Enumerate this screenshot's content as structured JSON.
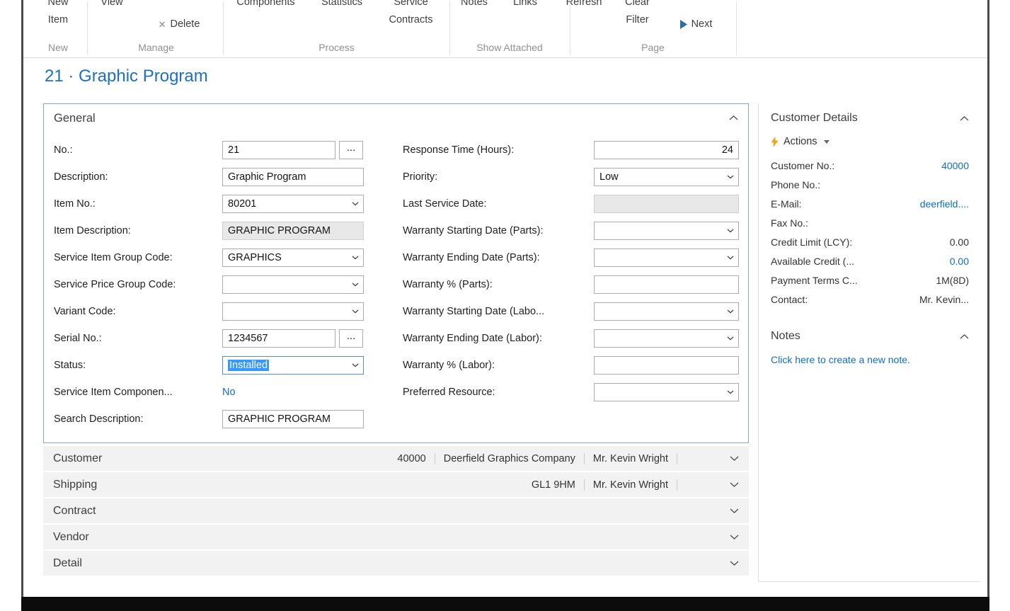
{
  "ribbon": {
    "buttons": [
      {
        "name": "new-item",
        "line1": "New",
        "line2": "Item"
      },
      {
        "name": "view",
        "line1": "View",
        "line2": ""
      },
      {
        "name": "delete",
        "line1": "Delete",
        "line2": ""
      },
      {
        "name": "components",
        "line1": "Components",
        "line2": ""
      },
      {
        "name": "statistics",
        "line1": "Statistics",
        "line2": ""
      },
      {
        "name": "service-contracts",
        "line1": "Service",
        "line2": "Contracts"
      },
      {
        "name": "notes",
        "line1": "Notes",
        "line2": ""
      },
      {
        "name": "links",
        "line1": "Links",
        "line2": ""
      },
      {
        "name": "refresh",
        "line1": "Refresh",
        "line2": ""
      },
      {
        "name": "clear-filter",
        "line1": "Clear",
        "line2": "Filter"
      },
      {
        "name": "next",
        "line1": "Next",
        "line2": ""
      }
    ],
    "groups": [
      "New",
      "Manage",
      "Process",
      "Show Attached",
      "Page"
    ]
  },
  "icons": {
    "delete": "✕"
  },
  "page": {
    "title": "21 · Graphic Program"
  },
  "general": {
    "header": "General",
    "assist_label": "...",
    "left_fields": [
      {
        "label": "No.:",
        "value": "21"
      },
      {
        "label": "Description:",
        "value": "Graphic Program"
      },
      {
        "label": "Item No.:",
        "value": "80201"
      },
      {
        "label": "Item Description:",
        "value": "GRAPHIC PROGRAM"
      },
      {
        "label": "Service Item Group Code:",
        "value": "GRAPHICS"
      },
      {
        "label": "Service Price Group Code:",
        "value": ""
      },
      {
        "label": "Variant Code:",
        "value": ""
      },
      {
        "label": "Serial No.:",
        "value": "1234567"
      },
      {
        "label": "Status:",
        "value": "Installed"
      },
      {
        "label": "Service Item Componen...",
        "value": "No"
      },
      {
        "label": "Search Description:",
        "value": "GRAPHIC PROGRAM"
      }
    ],
    "right_fields": [
      {
        "label": "Response Time (Hours):",
        "value": "24"
      },
      {
        "label": "Priority:",
        "value": "Low"
      },
      {
        "label": "Last Service Date:",
        "value": ""
      },
      {
        "label": "Warranty Starting Date (Parts):",
        "value": ""
      },
      {
        "label": "Warranty Ending Date (Parts):",
        "value": ""
      },
      {
        "label": "Warranty % (Parts):",
        "value": ""
      },
      {
        "label": "Warranty Starting Date (Labo...",
        "value": ""
      },
      {
        "label": "Warranty Ending Date (Labor):",
        "value": ""
      },
      {
        "label": "Warranty % (Labor):",
        "value": ""
      },
      {
        "label": "Preferred Resource:",
        "value": ""
      }
    ]
  },
  "fasttabs": [
    {
      "label": "Customer",
      "summary": [
        "40000",
        "Deerfield Graphics Company",
        "Mr. Kevin Wright"
      ]
    },
    {
      "label": "Shipping",
      "summary": [
        "GL1 9HM",
        "Mr. Kevin Wright"
      ]
    },
    {
      "label": "Contract",
      "summary": []
    },
    {
      "label": "Vendor",
      "summary": []
    },
    {
      "label": "Detail",
      "summary": []
    }
  ],
  "factbox": {
    "customer_details": {
      "title": "Customer Details",
      "actions_label": "Actions",
      "rows": [
        {
          "label": "Customer No.:",
          "value": "40000"
        },
        {
          "label": "Phone No.:",
          "value": ""
        },
        {
          "label": "E-Mail:",
          "value": "deerfield...."
        },
        {
          "label": "Fax No.:",
          "value": ""
        },
        {
          "label": "Credit Limit (LCY):",
          "value": "0.00"
        },
        {
          "label": "Available Credit (...",
          "value": "0.00"
        },
        {
          "label": "Payment Terms C...",
          "value": "1M(8D)"
        },
        {
          "label": "Contact:",
          "value": "Mr. Kevin..."
        }
      ]
    },
    "notes": {
      "title": "Notes",
      "empty_text": "Click here to create a new note."
    }
  },
  "colors": {
    "title_blue": "#1c70c0",
    "link_blue": "#0e6fc1",
    "selection_blue": "#3598ff"
  }
}
